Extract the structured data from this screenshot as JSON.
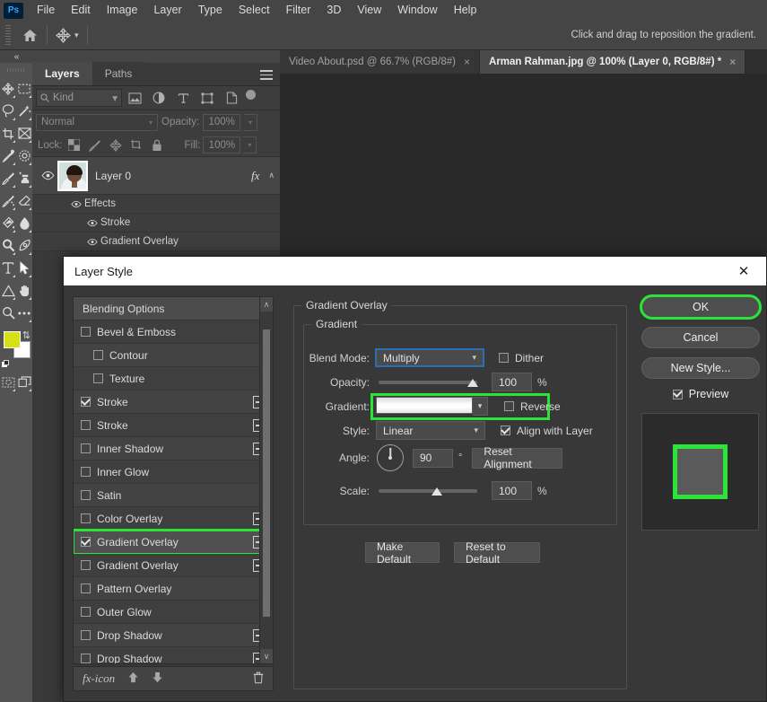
{
  "menubar": {
    "logo": "Ps",
    "items": [
      "File",
      "Edit",
      "Image",
      "Layer",
      "Type",
      "Select",
      "Filter",
      "3D",
      "View",
      "Window",
      "Help"
    ]
  },
  "optionsbar": {
    "home_icon": "home-icon",
    "tool_icon": "move-tool-icon",
    "hint": "Click and drag to reposition the gradient."
  },
  "toolbar": {
    "collapse": "«",
    "tools": [
      "move-tool",
      "rectangular-marquee-tool",
      "lasso-tool",
      "object-selection-tool",
      "crop-tool",
      "frame-tool",
      "eyedropper-tool",
      "spot-healing-brush-tool",
      "brush-tool",
      "clone-stamp-tool",
      "history-brush-tool",
      "eraser-tool",
      "gradient-tool",
      "blur-tool",
      "dodge-tool",
      "pen-tool",
      "horizontal-type-tool",
      "path-selection-tool",
      "shape-tool",
      "hand-tool",
      "zoom-tool",
      "edit-toolbar-tool"
    ],
    "foreground_color": "#d7e017",
    "background_color": "#ffffff",
    "quickmask_icon": "quick-mask-icon",
    "screenmode_icon": "screen-mode-icon"
  },
  "layers_panel": {
    "tabs": [
      {
        "label": "Layers",
        "active": true
      },
      {
        "label": "Paths",
        "active": false
      }
    ],
    "menu_icon": "panel-menu-icon",
    "filter": {
      "kind_label": "Kind",
      "search_icon": "search-icon",
      "icons": [
        "pixel-filter-icon",
        "adjustment-filter-icon",
        "type-filter-icon",
        "shape-filter-icon",
        "smartobject-filter-icon"
      ],
      "toggle": "filter-toggle"
    },
    "blend": {
      "mode": "Normal",
      "opacity_label": "Opacity:",
      "opacity_value": "100%"
    },
    "lock": {
      "label": "Lock:",
      "icons": [
        "lock-transparent-pixels-icon",
        "lock-image-pixels-icon",
        "lock-position-icon",
        "lock-artboard-icon",
        "lock-all-icon"
      ],
      "fill_label": "Fill:",
      "fill_value": "100%"
    },
    "layers": [
      {
        "name": "Layer 0",
        "visible": true,
        "fx": "fx",
        "chevron": "∧",
        "effects": [
          {
            "label": "Effects",
            "level": 1
          },
          {
            "label": "Stroke",
            "level": 2
          },
          {
            "label": "Gradient Overlay",
            "level": 2
          }
        ]
      }
    ]
  },
  "doc_tabs": [
    {
      "label": "Video About.psd @ 66.7% (RGB/8#)",
      "active": false,
      "close": "×"
    },
    {
      "label": "Arman Rahman.jpg @ 100% (Layer 0, RGB/8#) *",
      "active": true,
      "close": "×"
    }
  ],
  "dialog": {
    "title": "Layer Style",
    "close_icon": "close-icon",
    "styles_header": "Blending Options",
    "styles": [
      {
        "label": "Bevel & Emboss",
        "checked": false,
        "plus": false,
        "indent": false,
        "highlight": false
      },
      {
        "label": "Contour",
        "checked": false,
        "plus": false,
        "indent": true,
        "highlight": false
      },
      {
        "label": "Texture",
        "checked": false,
        "plus": false,
        "indent": true,
        "highlight": false
      },
      {
        "label": "Stroke",
        "checked": true,
        "plus": true,
        "indent": false,
        "highlight": false
      },
      {
        "label": "Stroke",
        "checked": false,
        "plus": true,
        "indent": false,
        "highlight": false
      },
      {
        "label": "Inner Shadow",
        "checked": false,
        "plus": true,
        "indent": false,
        "highlight": false
      },
      {
        "label": "Inner Glow",
        "checked": false,
        "plus": false,
        "indent": false,
        "highlight": false
      },
      {
        "label": "Satin",
        "checked": false,
        "plus": false,
        "indent": false,
        "highlight": false
      },
      {
        "label": "Color Overlay",
        "checked": false,
        "plus": true,
        "indent": false,
        "highlight": false
      },
      {
        "label": "Gradient Overlay",
        "checked": true,
        "plus": true,
        "indent": false,
        "highlight": true
      },
      {
        "label": "Gradient Overlay",
        "checked": false,
        "plus": true,
        "indent": false,
        "highlight": false
      },
      {
        "label": "Pattern Overlay",
        "checked": false,
        "plus": false,
        "indent": false,
        "highlight": false
      },
      {
        "label": "Outer Glow",
        "checked": false,
        "plus": false,
        "indent": false,
        "highlight": false
      },
      {
        "label": "Drop Shadow",
        "checked": false,
        "plus": true,
        "indent": false,
        "highlight": false
      },
      {
        "label": "Drop Shadow",
        "checked": false,
        "plus": true,
        "indent": false,
        "highlight": false
      }
    ],
    "footer": {
      "fx_icon": "fx-icon",
      "up_icon": "move-up-icon",
      "down_icon": "move-down-icon",
      "trash_icon": "trash-icon"
    },
    "scrollbar": {
      "up": "∧",
      "down": "∨"
    },
    "panel": {
      "section_title": "Gradient Overlay",
      "group_title": "Gradient",
      "blend_mode_label": "Blend Mode:",
      "blend_mode_value": "Multiply",
      "dither_label": "Dither",
      "dither_checked": false,
      "opacity_label": "Opacity:",
      "opacity_value": "100",
      "opacity_unit": "%",
      "gradient_label": "Gradient:",
      "gradient_colors": "#d8d8d8 → #ffffff → #e6e6e6",
      "reverse_label": "Reverse",
      "reverse_checked": false,
      "style_label": "Style:",
      "style_value": "Linear",
      "align_label": "Align with Layer",
      "align_checked": true,
      "angle_label": "Angle:",
      "angle_value": "90",
      "angle_unit": "°",
      "reset_alignment_label": "Reset Alignment",
      "scale_label": "Scale:",
      "scale_value": "100",
      "scale_unit": "%",
      "make_default_label": "Make Default",
      "reset_default_label": "Reset to Default"
    },
    "buttons": {
      "ok": "OK",
      "cancel": "Cancel",
      "new_style": "New Style...",
      "preview_label": "Preview",
      "preview_checked": true
    },
    "preview": {
      "stroke_color": "#2ce338",
      "fill_color": "#5a5a5a"
    },
    "highlight_color": "#2ce338"
  }
}
